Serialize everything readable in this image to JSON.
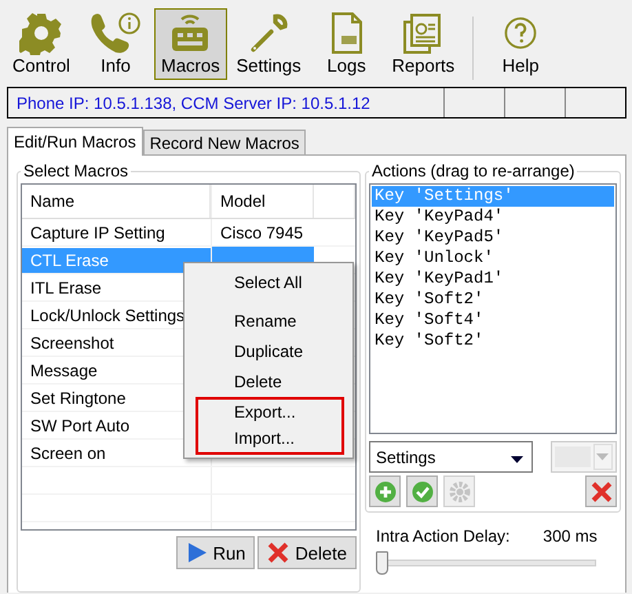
{
  "toolbar": [
    {
      "label": "Control",
      "kind": "gear",
      "selected": false,
      "separated": false
    },
    {
      "label": "Info",
      "kind": "phone-info",
      "selected": false,
      "separated": false
    },
    {
      "label": "Macros",
      "kind": "keyboard",
      "selected": true,
      "separated": false
    },
    {
      "label": "Settings",
      "kind": "wrench",
      "selected": false,
      "separated": false
    },
    {
      "label": "Logs",
      "kind": "log",
      "selected": false,
      "separated": false
    },
    {
      "label": "Reports",
      "kind": "reports",
      "selected": false,
      "separated": false
    },
    {
      "label": "Help",
      "kind": "help",
      "selected": false,
      "separated": true
    }
  ],
  "status_bar": {
    "text": "Phone IP: 10.5.1.138, CCM Server IP: 10.5.1.12"
  },
  "tabs": [
    {
      "label": "Edit/Run Macros",
      "selected": true
    },
    {
      "label": "Record New Macros",
      "selected": false
    }
  ],
  "select_macros": {
    "title": "Select Macros",
    "columns": [
      "Name",
      "Model"
    ],
    "rows": [
      {
        "name": "Capture IP Setting",
        "model": "Cisco 7945",
        "selected": false
      },
      {
        "name": "CTL Erase",
        "selected": true
      },
      {
        "name": "ITL Erase",
        "selected": false
      },
      {
        "name": "Lock/Unlock Settings",
        "selected": false
      },
      {
        "name": "Screenshot",
        "selected": false
      },
      {
        "name": "Message",
        "selected": false
      },
      {
        "name": "Set Ringtone",
        "selected": false
      },
      {
        "name": "SW Port Auto",
        "selected": false
      },
      {
        "name": "Screen on",
        "selected": false
      }
    ],
    "buttons": [
      {
        "label": "Run",
        "kind": "run"
      },
      {
        "label": "Delete",
        "kind": "delete"
      }
    ]
  },
  "context_menu": {
    "items": [
      {
        "label": "Select All",
        "outlined": false
      },
      {
        "label": "Rename",
        "outlined": false
      },
      {
        "label": "Duplicate",
        "outlined": false
      },
      {
        "label": "Delete",
        "outlined": false
      },
      {
        "label": "Export...",
        "outlined": true
      },
      {
        "label": "Import...",
        "outlined": true
      }
    ]
  },
  "actions": {
    "title": "Actions (drag to re-arrange)",
    "items": [
      {
        "text": "Key 'Settings'",
        "selected": true
      },
      {
        "text": "Key 'KeyPad4'",
        "selected": false
      },
      {
        "text": "Key 'KeyPad5'",
        "selected": false
      },
      {
        "text": "Key 'Unlock'",
        "selected": false
      },
      {
        "text": "Key 'KeyPad1'",
        "selected": false
      },
      {
        "text": "Key 'Soft2'",
        "selected": false
      },
      {
        "text": "Key 'Soft4'",
        "selected": false
      },
      {
        "text": "Key 'Soft2'",
        "selected": false
      }
    ],
    "dropdown": {
      "value": "Settings"
    },
    "tool_buttons": [
      {
        "kind": "add",
        "disabled": false
      },
      {
        "kind": "apply",
        "disabled": false
      },
      {
        "kind": "gear",
        "disabled": true
      },
      {
        "kind": "remove",
        "disabled": false
      }
    ]
  },
  "delay": {
    "label": "Intra Action Delay:",
    "reading": "300 ms",
    "level": 0
  }
}
